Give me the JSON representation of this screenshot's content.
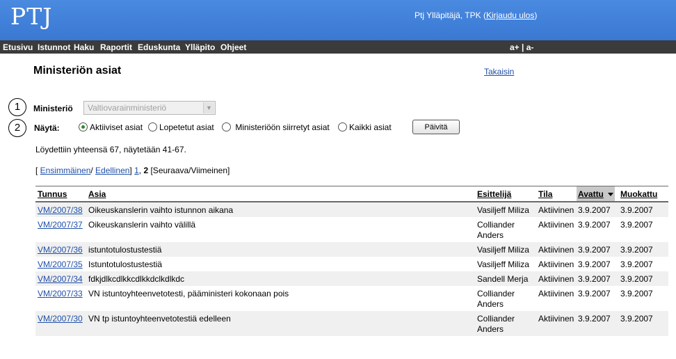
{
  "header": {
    "logo": "PTJ",
    "user_text": "Ptj Ylläpitäjä, TPK (",
    "logout": "Kirjaudu ulos",
    "user_close": ")"
  },
  "nav": {
    "items": [
      "Etusivu",
      "Istunnot",
      "Haku",
      "Raportit",
      "Eduskunta",
      "Ylläpito",
      "Ohjeet"
    ],
    "font_plus": "a+",
    "font_sep": " | ",
    "font_minus": "a-"
  },
  "page": {
    "title": "Ministeriön asiat",
    "back": "Takaisin"
  },
  "filters": {
    "step1": "1",
    "step2": "2",
    "ministry_label": "Ministeriö",
    "ministry_value": "Valtiovarainministeriö",
    "show_label": "Näytä:",
    "options": [
      {
        "label": "Aktiiviset asiat",
        "selected": true
      },
      {
        "label": "Lopetetut asiat",
        "selected": false
      },
      {
        "label": "Ministeriöön siirretyt asiat",
        "selected": false
      },
      {
        "label": "Kaikki asiat",
        "selected": false
      }
    ],
    "refresh": "Päivitä"
  },
  "results": {
    "summary": "Löydettiin yhteensä 67, näytetään 41-67."
  },
  "pager": {
    "open": "[ ",
    "first": "Ensimmäinen",
    "slash1": "/ ",
    "prev": "Edellinen",
    "close1": "] ",
    "page1": "1",
    "comma": ", ",
    "page2": "2",
    "rest": " [Seuraava/Viimeinen]"
  },
  "table": {
    "columns": [
      "Tunnus",
      "Asia",
      "Esittelijä",
      "Tila",
      "Avattu",
      "Muokattu"
    ],
    "rows": [
      {
        "id": "VM/2007/38",
        "subject": "Oikeuskanslerin vaihto istunnon aikana",
        "presenter": "Vasiljeff Miliza",
        "state": "Aktiivinen",
        "opened": "3.9.2007",
        "modified": "3.9.2007"
      },
      {
        "id": "VM/2007/37",
        "subject": "Oikeuskanslerin vaihto välillä",
        "presenter": "Colliander Anders",
        "state": "Aktiivinen",
        "opened": "3.9.2007",
        "modified": "3.9.2007"
      },
      {
        "id": "VM/2007/36",
        "subject": "istuntotulostustestiä",
        "presenter": "Vasiljeff Miliza",
        "state": "Aktiivinen",
        "opened": "3.9.2007",
        "modified": "3.9.2007"
      },
      {
        "id": "VM/2007/35",
        "subject": "Istuntotulostustestiä",
        "presenter": "Vasiljeff Miliza",
        "state": "Aktiivinen",
        "opened": "3.9.2007",
        "modified": "3.9.2007"
      },
      {
        "id": "VM/2007/34",
        "subject": "fdkjdlkcdlkkcdlkkdclkdlkdc",
        "presenter": "Sandell Merja",
        "state": "Aktiivinen",
        "opened": "3.9.2007",
        "modified": "3.9.2007"
      },
      {
        "id": "VM/2007/33",
        "subject": "VN istuntoyhteenvetotesti, pääministeri kokonaan pois",
        "presenter": "Colliander Anders",
        "state": "Aktiivinen",
        "opened": "3.9.2007",
        "modified": "3.9.2007"
      },
      {
        "id": "VM/2007/30",
        "subject": "VN tp istuntoyhteenvetotestiä edelleen",
        "presenter": "Colliander Anders",
        "state": "Aktiivinen",
        "opened": "3.9.2007",
        "modified": "3.9.2007"
      }
    ]
  }
}
